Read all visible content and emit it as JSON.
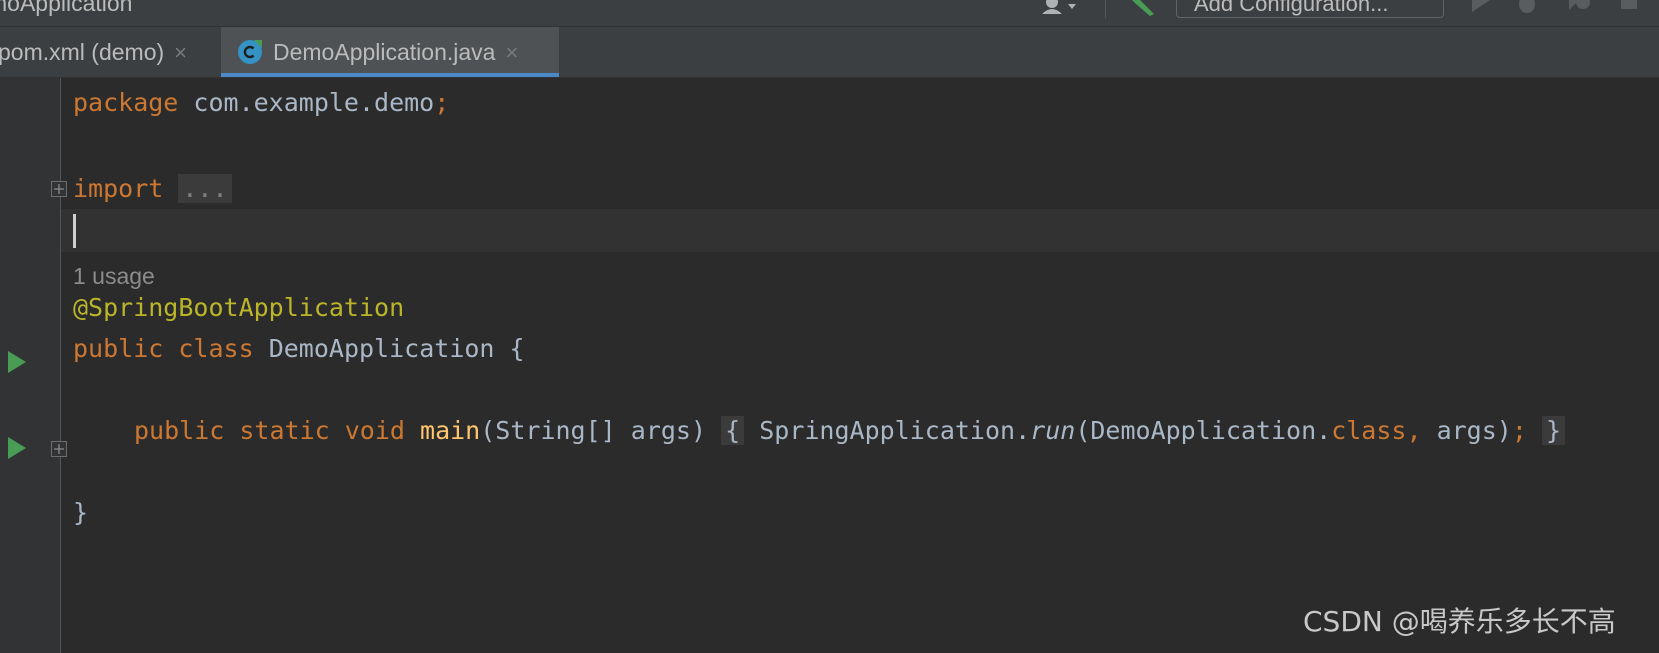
{
  "toolbar": {
    "project_name": "moApplication",
    "config_label": "Add Configuration..."
  },
  "tabs": [
    {
      "label": "pom.xml (demo)",
      "close": "×"
    },
    {
      "label": "DemoApplication.java",
      "close": "×"
    }
  ],
  "code": {
    "l1_kw": "package",
    "l1_rest": " com.example.demo",
    "l1_semi": ";",
    "l2_kw": "import",
    "l2_dots": "...",
    "usage_hint": "1 usage",
    "l4_ann": "@SpringBootApplication",
    "l5_kw1": "public",
    "l5_kw2": "class",
    "l5_name": "DemoApplication",
    "l5_brace": "{",
    "l6_kw1": "public",
    "l6_kw2": "static",
    "l6_kw3": "void",
    "l6_fn": "main",
    "l6_params": "(String[] args)",
    "l6_open": "{",
    "l6_cls": "SpringApplication",
    "l6_dot": ".",
    "l6_run": "run",
    "l6_arg1": "(DemoApplication.",
    "l6_class": "class",
    "l6_comma": ",",
    "l6_arg2": " args)",
    "l6_semi": ";",
    "l6_close": "}",
    "l7_brace": "}"
  },
  "watermark": "CSDN @喝养乐多长不高",
  "colors": {
    "keyword": "#cc7832",
    "annotation": "#bbb529",
    "function": "#ffc66d",
    "text": "#a9b7c6",
    "tab_underline": "#4a88c7",
    "run_green": "#499c54"
  }
}
